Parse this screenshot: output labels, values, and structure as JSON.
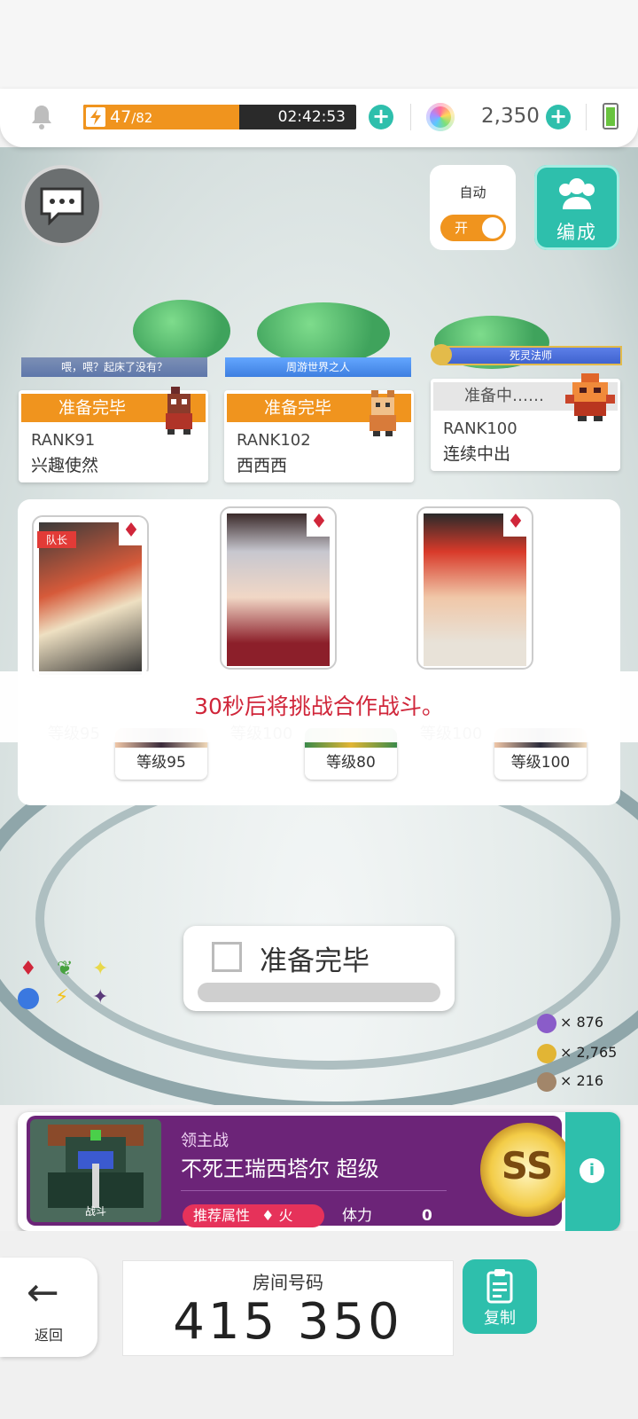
{
  "topbar": {
    "stamina_current": "47",
    "stamina_max": "/82",
    "stamina_fraction": 0.573,
    "timer": "02:42:53",
    "gems": "2,350"
  },
  "auto": {
    "label": "自动",
    "toggle_text": "开",
    "on": true
  },
  "team_button": "编成",
  "players": [
    {
      "title": "喂，喂？起床了没有？",
      "status": "准备完毕",
      "rank": "RANK91",
      "name": "兴趣使然"
    },
    {
      "title": "周游世界之人",
      "status": "准备完毕",
      "rank": "RANK102",
      "name": "西西西"
    },
    {
      "title": "死灵法师",
      "status": "准备中……",
      "rank": "RANK100",
      "name": "连续中出"
    }
  ],
  "captain_label": "队长",
  "toast": "30秒后将挑战合作战斗。",
  "heroes": [
    {
      "main_level": "等级95",
      "sub_level": "等级95"
    },
    {
      "main_level": "等级100",
      "sub_level": "等级80"
    },
    {
      "main_level": "等级100",
      "sub_level": "等级100"
    }
  ],
  "ready_button": "准备完毕",
  "resources": [
    {
      "icon": "purple-medal-icon",
      "value": "× 876",
      "color": "#8a5cc9"
    },
    {
      "icon": "gold-medal-icon",
      "value": "× 2,765",
      "color": "#e2b534"
    },
    {
      "icon": "bronze-medal-icon",
      "value": "× 216",
      "color": "#a2866a"
    }
  ],
  "boss": {
    "category": "领主战",
    "name": "不死王瑞西塔尔 超级",
    "art_label": "战斗",
    "tag": "推荐属性",
    "element": "火",
    "stamina_label": "体力",
    "stamina_value": "0",
    "grade": "SS"
  },
  "bottom": {
    "back": "返回",
    "room_label": "房间号码",
    "room_number": "415 350",
    "copy": "复制"
  },
  "colors": {
    "accent": "#2ebfac",
    "orange": "#f0941e",
    "boss_purple": "#6c2478",
    "red": "#d0263a"
  }
}
